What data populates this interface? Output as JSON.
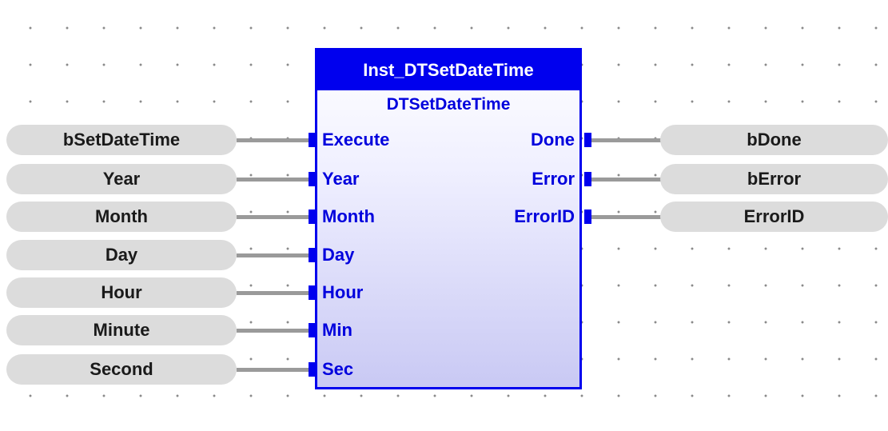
{
  "block": {
    "instance_name": "Inst_DTSetDateTime",
    "type_name": "DTSetDateTime",
    "inputs": [
      "Execute",
      "Year",
      "Month",
      "Day",
      "Hour",
      "Min",
      "Sec"
    ],
    "outputs": [
      "Done",
      "Error",
      "ErrorID"
    ]
  },
  "input_vars": [
    "bSetDateTime",
    "Year",
    "Month",
    "Day",
    "Hour",
    "Minute",
    "Second"
  ],
  "output_vars": [
    "bDone",
    "bError",
    "ErrorID"
  ],
  "colors": {
    "block_border": "#0000ee",
    "header_bg": "#0000ee",
    "port_text": "#0000dd",
    "variable_bg": "#dcdcdc",
    "wire": "#9a9a9a"
  }
}
